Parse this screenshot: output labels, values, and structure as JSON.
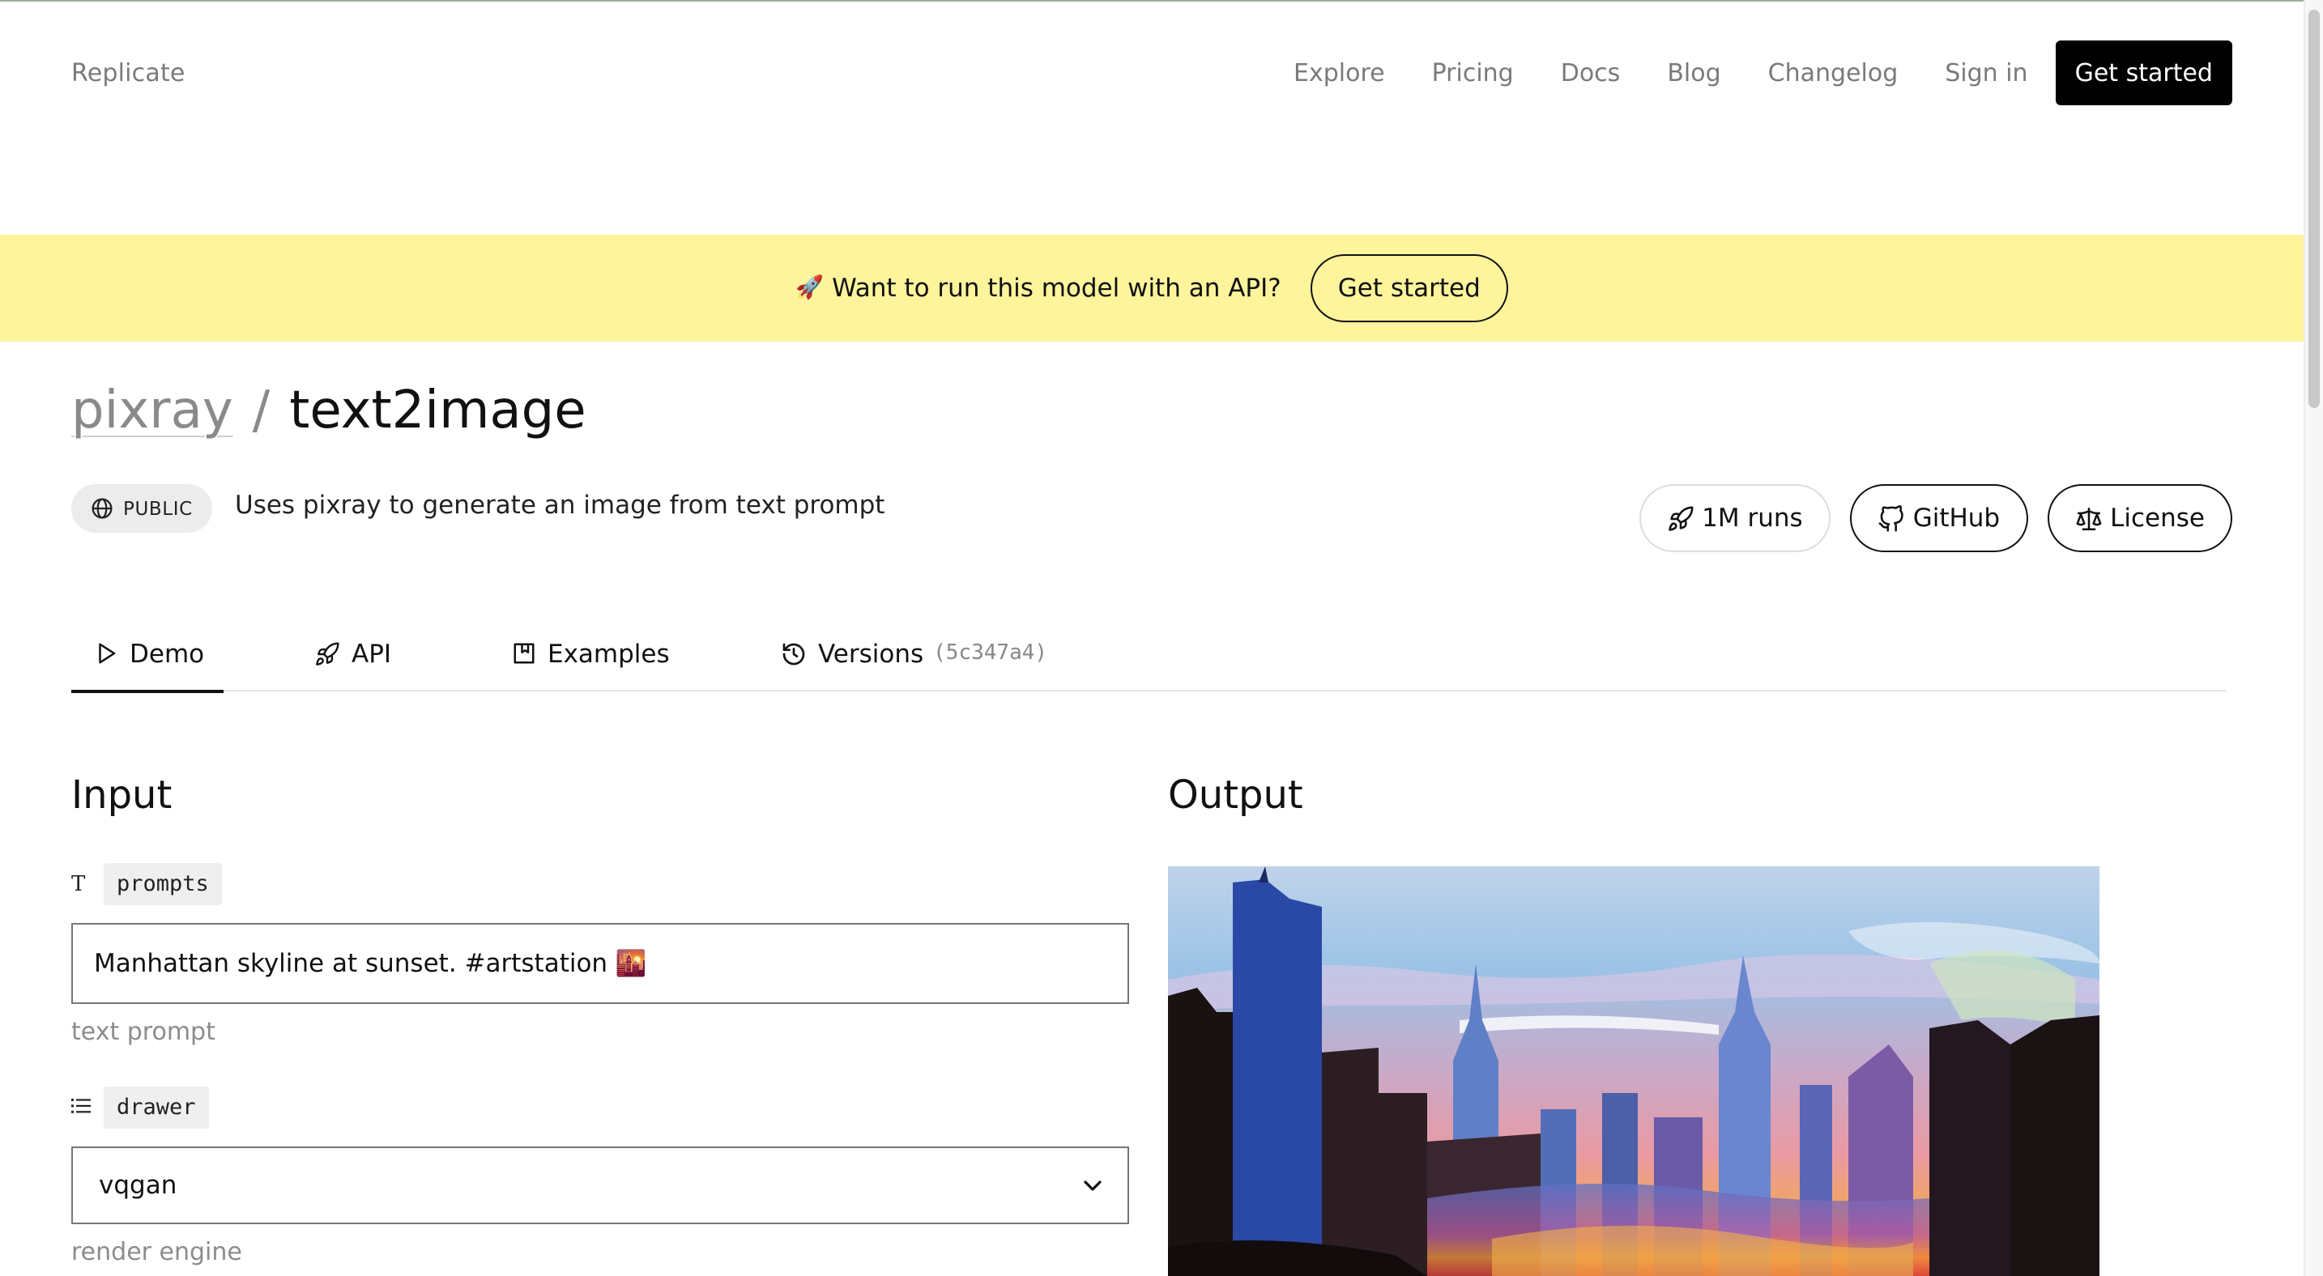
{
  "header": {
    "brand": "Replicate",
    "nav": [
      "Explore",
      "Pricing",
      "Docs",
      "Blog",
      "Changelog",
      "Sign in"
    ],
    "cta": "Get started"
  },
  "banner": {
    "emoji": "🚀",
    "message": "Want to run this model with an API?",
    "button": "Get started"
  },
  "model": {
    "owner": "pixray",
    "separator": "/",
    "name": "text2image",
    "visibility": "PUBLIC",
    "description": "Uses pixray to generate an image from text prompt",
    "runs": "1M runs",
    "github": "GitHub",
    "license": "License"
  },
  "tabs": {
    "demo": "Demo",
    "api": "API",
    "examples": "Examples",
    "versions": "Versions",
    "version_hash": "(5c347a4)"
  },
  "input": {
    "heading": "Input",
    "prompts": {
      "type_icon": "T",
      "name": "prompts",
      "value": "Manhattan skyline at sunset. #artstation 🌇",
      "hint": "text prompt"
    },
    "drawer": {
      "type_icon": "list-icon",
      "name": "drawer",
      "value": "vqgan",
      "hint": "render engine"
    }
  },
  "output": {
    "heading": "Output"
  },
  "colors": {
    "banner_bg": "#fdf49c",
    "cta_bg": "#000000",
    "muted_text": "#7a7a7a"
  }
}
